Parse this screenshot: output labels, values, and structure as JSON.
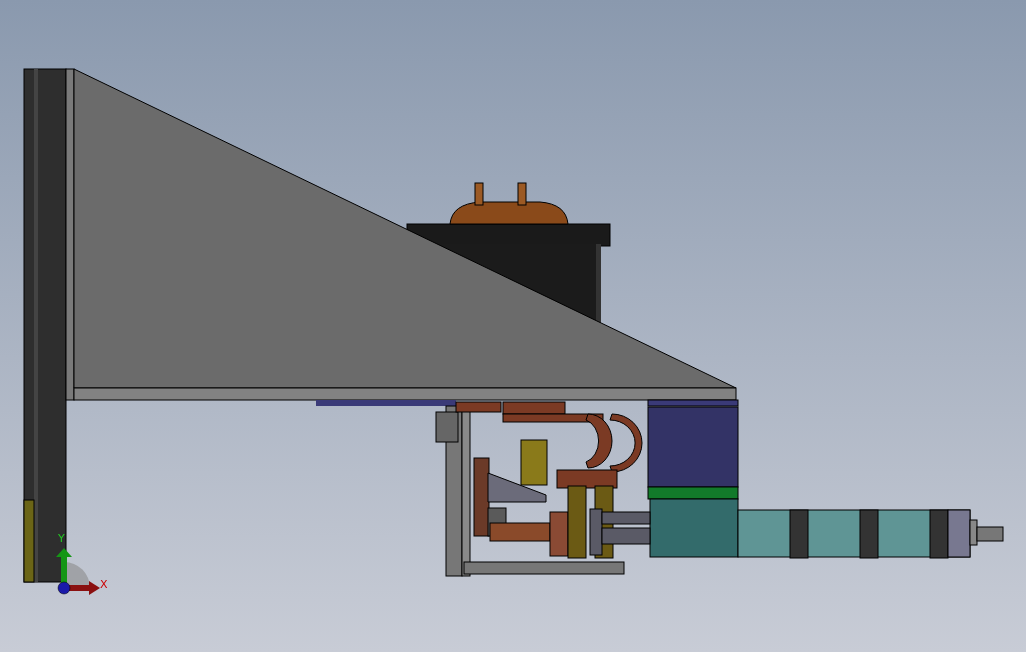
{
  "viewport": {
    "triad": {
      "axes": [
        {
          "kind": "y",
          "label": "Y"
        },
        {
          "kind": "x",
          "label": "X"
        }
      ]
    }
  }
}
